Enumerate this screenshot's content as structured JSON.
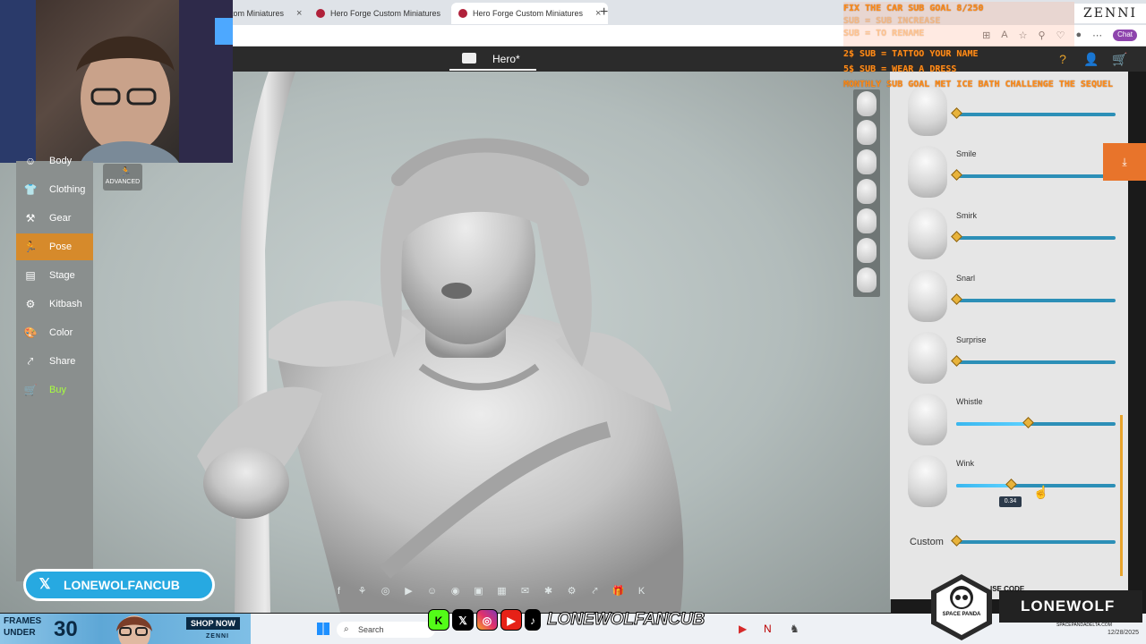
{
  "browser": {
    "tabs": [
      {
        "label": "tom Miniatures",
        "close": "×"
      },
      {
        "label": "Hero Forge Custom Miniatures",
        "close": "×"
      },
      {
        "label": "Hero Forge Custom Miniatures",
        "close": "×"
      }
    ],
    "new_tab": "+",
    "chat_label": "Chat"
  },
  "app": {
    "title": "Hero*",
    "nav": [
      {
        "label": "Clothing",
        "icon": "shirt-icon",
        "glyph": "👕"
      },
      {
        "label": "Gear",
        "icon": "gear-icon",
        "glyph": "⚒"
      },
      {
        "label": "Pose",
        "icon": "pose-icon",
        "glyph": "🏃"
      },
      {
        "label": "Stage",
        "icon": "stage-icon",
        "glyph": "▤"
      },
      {
        "label": "Kitbash",
        "icon": "kitbash-icon",
        "glyph": "⚙"
      },
      {
        "label": "Color",
        "icon": "palette-icon",
        "glyph": "🎨"
      },
      {
        "label": "Share",
        "icon": "share-icon",
        "glyph": "⤤"
      },
      {
        "label": "Buy",
        "icon": "cart-icon",
        "glyph": "🛒"
      }
    ],
    "partial_nav": "Body",
    "advanced_label": "ADVANCED"
  },
  "expressions": {
    "sliders": [
      {
        "label": "",
        "value": 0.0
      },
      {
        "label": "Smile",
        "value": 0.0
      },
      {
        "label": "Smirk",
        "value": 0.0
      },
      {
        "label": "Snarl",
        "value": 0.0
      },
      {
        "label": "Surprise",
        "value": 0.0
      },
      {
        "label": "Whistle",
        "value": 0.45
      },
      {
        "label": "Wink",
        "value": 0.34
      }
    ],
    "custom_label": "Custom",
    "custom_value": 0.0,
    "tooltip_value": "0.34"
  },
  "overlay": {
    "goals": [
      "FIX THE CAR SUB GOAL 8/250",
      " SUB = SUB INCREASE",
      " SUB = TO RENAME",
      "2$  SUB = TATTOO YOUR NAME",
      "5$ SUB = WEAR A DRESS",
      "MONTHLY SUB GOAL MET ICE BATH CHALLENGE THE SEQUEL"
    ],
    "brand": "ZENNI",
    "pill_handle": "LONEWOLFANCUB",
    "frames_text_1": "FRAMES",
    "frames_text_2": "UNDER",
    "frames_num": "30",
    "shop_now": "SHOP NOW",
    "zenni_small": "ZENNI",
    "social_handle": "LONEWOLFANCUB",
    "promo_code_label": "ISE CODE",
    "promo_name": "LONEWOLF",
    "promo_logo": "SPACE PANDA",
    "promo_url": "SPACEPANDADELTA.COM"
  },
  "taskbar": {
    "search_placeholder": "Search",
    "date": "12/28/2025"
  },
  "colors": {
    "accent": "#e8a32b",
    "slider_track": "#2c8fb7",
    "slider_fill": "#3ab7ef",
    "pose_active": "#d68a2b"
  }
}
